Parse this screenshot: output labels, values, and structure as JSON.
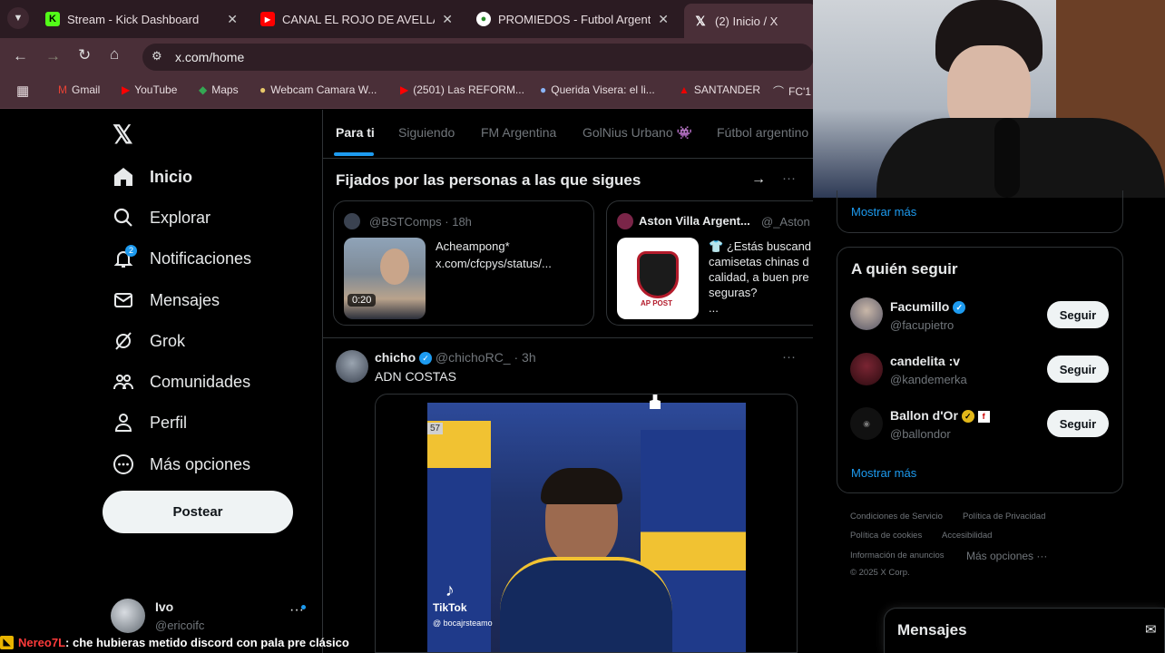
{
  "browser": {
    "tabs": [
      {
        "title": "Stream - Kick Dashboard",
        "icon": "kick-icon"
      },
      {
        "title": "CANAL EL ROJO DE AVELLANEDA",
        "icon": "youtube-icon"
      },
      {
        "title": "PROMIEDOS - Futbol Argentino",
        "icon": "soccer-ball-icon"
      },
      {
        "title": "(2) Inicio / X",
        "icon": "x-logo-icon"
      }
    ],
    "url": "x.com/home",
    "bookmarks": [
      "Gmail",
      "YouTube",
      "Maps",
      "Webcam Camara W...",
      "(2501) Las REFORM...",
      "Querida Visera: el li...",
      "SANTANDER",
      "FC'1"
    ]
  },
  "nav": {
    "items": [
      "Inicio",
      "Explorar",
      "Notificaciones",
      "Mensajes",
      "Grok",
      "Comunidades",
      "Perfil",
      "Más opciones"
    ],
    "notif_badge": "2",
    "post_button": "Postear",
    "account": {
      "name": "Ivo",
      "handle": "@ericoifc"
    }
  },
  "feed": {
    "tabs": [
      "Para ti",
      "Siguiendo",
      "FM Argentina",
      "GolNius Urbano",
      "Fútbol argentino"
    ],
    "pinned_header": "Fijados por las personas a las que sigues",
    "pinned": [
      {
        "handle": "@BSTComps · 18h",
        "text1": "Acheampong*",
        "text2": "x.com/cfcpys/status/...",
        "duration": "0:20"
      },
      {
        "name": "Aston Villa Argent...",
        "handle": "@_Aston",
        "lines": [
          "¿Estás buscand",
          "camisetas chinas d",
          "calidad, a buen pre",
          "seguras?",
          "..."
        ],
        "logo_text": "AP POST"
      }
    ],
    "post": {
      "name": "chicho",
      "handle": "@chichoRC_ · 3h",
      "text": "ADN COSTAS",
      "video_badge": "57",
      "watermark": "TikTok",
      "watermark_handle": "@ bocajrsteamo"
    }
  },
  "sidebar": {
    "show_more": "Mostrar más",
    "who_to_follow": "A quién seguir",
    "follow": [
      {
        "name": "Facumillo",
        "handle": "@facupietro",
        "button": "Seguir"
      },
      {
        "name": "candelita :v",
        "handle": "@kandemerka",
        "button": "Seguir"
      },
      {
        "name": "Ballon d'Or",
        "handle": "@ballondor",
        "button": "Seguir"
      }
    ],
    "show_more2": "Mostrar más",
    "footer": [
      "Condiciones de Servicio",
      "Política de Privacidad",
      "Política de cookies",
      "Accesibilidad",
      "Información de anuncios",
      "Más opciones ···",
      "© 2025 X Corp."
    ],
    "messages": "Mensajes"
  },
  "chat": {
    "user": "Nereo7L",
    "message": ": che hubieras metido discord con pala pre clásico"
  }
}
